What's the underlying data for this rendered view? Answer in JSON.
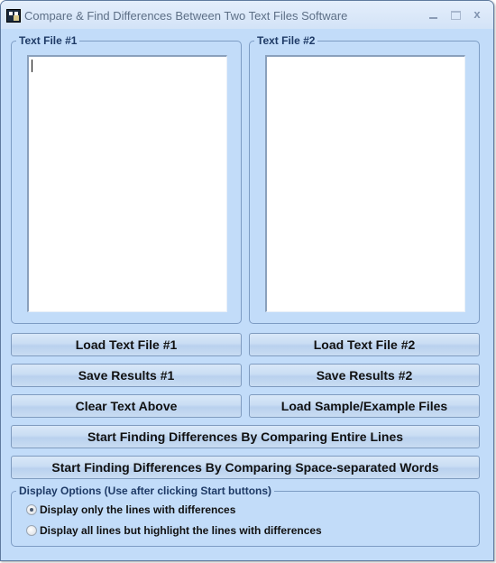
{
  "window": {
    "title": "Compare & Find Differences Between Two Text Files Software",
    "icon": "app-icon",
    "controls": {
      "minimize_icon": "minimize-icon",
      "maximize_icon": "maximize-icon",
      "close_label": "x"
    }
  },
  "file1": {
    "label": "Text File #1",
    "content": ""
  },
  "file2": {
    "label": "Text File #2",
    "content": ""
  },
  "buttons": {
    "load1": "Load Text File #1",
    "load2": "Load Text File #2",
    "save1": "Save Results #1",
    "save2": "Save Results #2",
    "clear": "Clear Text Above",
    "load_sample": "Load Sample/Example Files",
    "start_lines": "Start Finding Differences By Comparing Entire Lines",
    "start_words": "Start Finding Differences By Comparing Space-separated Words"
  },
  "display_options": {
    "label": "Display Options (Use after clicking Start buttons)",
    "options": [
      {
        "label": "Display only the lines with differences",
        "checked": true
      },
      {
        "label": "Display all lines but highlight the lines with differences",
        "checked": false
      }
    ]
  }
}
